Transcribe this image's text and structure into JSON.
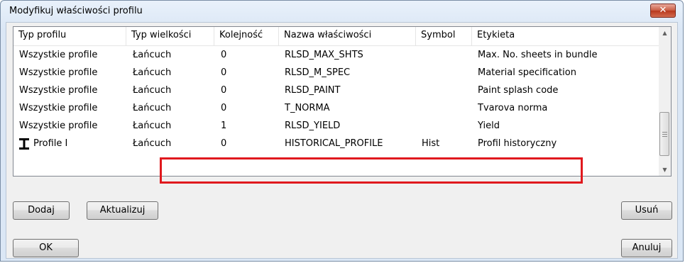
{
  "dialog": {
    "title": "Modyfikuj właściwości profilu",
    "close_label": "✕"
  },
  "list": {
    "columns": [
      "Typ profilu",
      "Typ wielkości",
      "Kolejność",
      "Nazwa właściwości",
      "Symbol",
      "Etykieta"
    ],
    "rows": [
      [
        "Wszystkie profile",
        "Łańcuch",
        "0",
        "RLSD_MAX_SHTS",
        "",
        "Max. No. sheets in bundle"
      ],
      [
        "Wszystkie profile",
        "Łańcuch",
        "0",
        "RLSD_M_SPEC",
        "",
        "Material specification"
      ],
      [
        "Wszystkie profile",
        "Łańcuch",
        "0",
        "RLSD_PAINT",
        "",
        "Paint splash code"
      ],
      [
        "Wszystkie profile",
        "Łańcuch",
        "0",
        "T_NORMA",
        "",
        "Tvarova norma"
      ],
      [
        "Wszystkie profile",
        "Łańcuch",
        "1",
        "RLSD_YIELD",
        "",
        "Yield"
      ],
      [
        "Profile I",
        "Łańcuch",
        "0",
        "HISTORICAL_PROFILE",
        "Hist",
        "Profil historyczny"
      ]
    ],
    "profile_icon": "i-beam-icon"
  },
  "buttons": {
    "add": "Dodaj",
    "update": "Aktualizuj",
    "delete": "Usuń",
    "ok": "OK",
    "cancel": "Anuluj"
  },
  "colors": {
    "highlight": "#e0191e"
  }
}
